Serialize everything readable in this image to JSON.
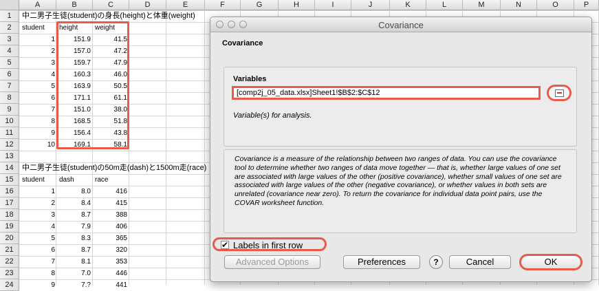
{
  "sheet": {
    "columns": [
      "A",
      "B",
      "C",
      "D",
      "E",
      "F",
      "G",
      "H",
      "I",
      "J",
      "K",
      "L",
      "M",
      "N",
      "O",
      "P"
    ],
    "rows": [
      "1",
      "2",
      "3",
      "4",
      "5",
      "6",
      "7",
      "8",
      "9",
      "10",
      "11",
      "12",
      "13",
      "14",
      "15",
      "16",
      "17",
      "18",
      "19",
      "20",
      "21",
      "22",
      "23",
      "24"
    ],
    "title1": "中二男子生徒(student)の身長(height)と体重(weight)",
    "headers1": [
      "student",
      "height",
      "weight"
    ],
    "data1": [
      [
        "1",
        "151.9",
        "41.5"
      ],
      [
        "2",
        "157.0",
        "47.2"
      ],
      [
        "3",
        "159.7",
        "47.9"
      ],
      [
        "4",
        "160.3",
        "46.0"
      ],
      [
        "5",
        "163.9",
        "50.5"
      ],
      [
        "6",
        "171.1",
        "61.1"
      ],
      [
        "7",
        "151.0",
        "38.0"
      ],
      [
        "8",
        "168.5",
        "51.8"
      ],
      [
        "9",
        "156.4",
        "43.8"
      ],
      [
        "10",
        "169.1",
        "58.1"
      ]
    ],
    "title2": "中二男子生徒(student)の50m走(dash)と1500m走(race)",
    "headers2": [
      "student",
      "dash",
      "race"
    ],
    "data2": [
      [
        "1",
        "8.0",
        "416"
      ],
      [
        "2",
        "8.4",
        "415"
      ],
      [
        "3",
        "8.7",
        "388"
      ],
      [
        "4",
        "7.9",
        "406"
      ],
      [
        "5",
        "8.3",
        "365"
      ],
      [
        "6",
        "8.7",
        "320"
      ],
      [
        "7",
        "8.1",
        "353"
      ],
      [
        "8",
        "7.0",
        "446"
      ],
      [
        "9",
        "7.?",
        "441"
      ]
    ]
  },
  "dialog": {
    "title": "Covariance",
    "heading": "Covariance",
    "variables_label": "Variables",
    "variables_value": "[comp2j_05_data.xlsx]Sheet1!$B$2:$C$12",
    "variables_help": "Variable(s) for analysis.",
    "description": "Covariance is a measure of the relationship between two ranges of data. You can use the covariance tool to determine whether two ranges of data move together — that is, whether large values of one set are associated with large values of the other (positive covariance), whether small values of one set are associated with large values of the other (negative covariance), or whether values in both sets are unrelated (covariance near zero). To return the covariance for individual data point pairs, use the COVAR worksheet function.",
    "labels_checkbox": "Labels in first row",
    "labels_checked": "✔",
    "buttons": {
      "advanced": "Advanced Options",
      "preferences": "Preferences",
      "help": "?",
      "cancel": "Cancel",
      "ok": "OK"
    }
  },
  "colors": {
    "highlight": "#e85b4a"
  }
}
